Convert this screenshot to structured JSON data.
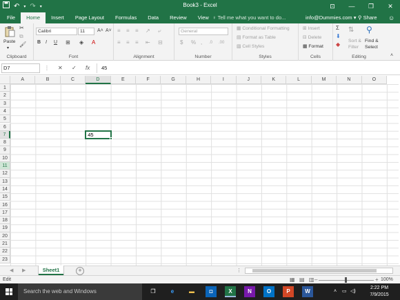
{
  "window": {
    "title": "Book3 - Excel",
    "controls": [
      "⊡",
      "—",
      "❐",
      "✕"
    ]
  },
  "ribbon_tabs": [
    "File",
    "Home",
    "Insert",
    "Page Layout",
    "Formulas",
    "Data",
    "Review",
    "View"
  ],
  "tell_me": "Tell me what you want to do...",
  "user": "info@Dummies.com",
  "share": "Share",
  "ribbon": {
    "clipboard": {
      "label": "Clipboard",
      "paste": "Paste"
    },
    "font": {
      "label": "Font",
      "name": "Calibri",
      "size": "11"
    },
    "alignment": {
      "label": "Alignment"
    },
    "number": {
      "label": "Number",
      "format": "General"
    },
    "styles": {
      "label": "Styles",
      "conditional": "Conditional Formatting",
      "format_table": "Format as Table",
      "cell_styles": "Cell Styles"
    },
    "cells": {
      "label": "Cells",
      "insert": "Insert",
      "delete": "Delete",
      "format": "Format"
    },
    "editing": {
      "label": "Editing",
      "sort": "Sort &",
      "filter": "Filter",
      "find": "Find &",
      "select": "Select"
    }
  },
  "formula_bar": {
    "name_box": "D7",
    "fx": "fx",
    "value": "45"
  },
  "grid": {
    "columns": [
      "A",
      "B",
      "C",
      "D",
      "E",
      "F",
      "G",
      "H",
      "I",
      "J",
      "K",
      "L",
      "M",
      "N",
      "O"
    ],
    "rows": [
      "1",
      "2",
      "3",
      "4",
      "5",
      "6",
      "7",
      "8",
      "9",
      "10",
      "11",
      "12",
      "13",
      "14",
      "15",
      "16",
      "17",
      "18",
      "19",
      "20",
      "21",
      "22",
      "23"
    ],
    "active_cell": {
      "ref": "D7",
      "value": "45"
    }
  },
  "sheets": [
    "Sheet1"
  ],
  "status": {
    "mode": "Edit",
    "zoom": "100%"
  },
  "taskbar": {
    "search": "Search the web and Windows",
    "apps": [
      "X",
      "N",
      "O",
      "P",
      "W"
    ],
    "time": "2:22 PM",
    "date": "7/9/2015"
  },
  "colors": {
    "excel_green": "#217346",
    "taskbar": "#1f1f1f"
  }
}
